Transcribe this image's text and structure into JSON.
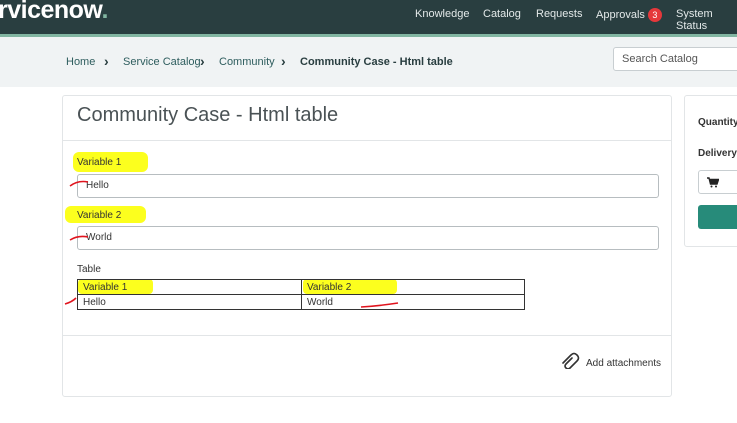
{
  "header": {
    "logo": "rvicenow",
    "logo_dot": ".",
    "nav": [
      "Knowledge",
      "Catalog",
      "Requests",
      "Approvals",
      "System Status"
    ],
    "approvals_badge": "3"
  },
  "breadcrumb": {
    "items": [
      "Home",
      "Service Catalog",
      "Community"
    ],
    "current": "Community Case - Html table"
  },
  "search": {
    "placeholder": "Search Catalog"
  },
  "form": {
    "title": "Community Case - Html table",
    "variable1_label": "Variable 1",
    "variable1_value": "Hello",
    "variable2_label": "Variable 2",
    "variable2_value": "World",
    "table_label": "Table",
    "table": {
      "headers": [
        "Variable 1",
        "Variable 2"
      ],
      "rows": [
        [
          "Hello",
          "World"
        ]
      ]
    },
    "attachments_label": "Add attachments"
  },
  "sidebar": {
    "quantity_label": "Quantity",
    "delivery_label": "Delivery"
  },
  "colors": {
    "topbar": "#293e40",
    "accent": "#81b5a1",
    "highlight": "#fcff1e",
    "annotation": "#e0141e",
    "button": "#278b7a",
    "badge": "#e5383b"
  }
}
